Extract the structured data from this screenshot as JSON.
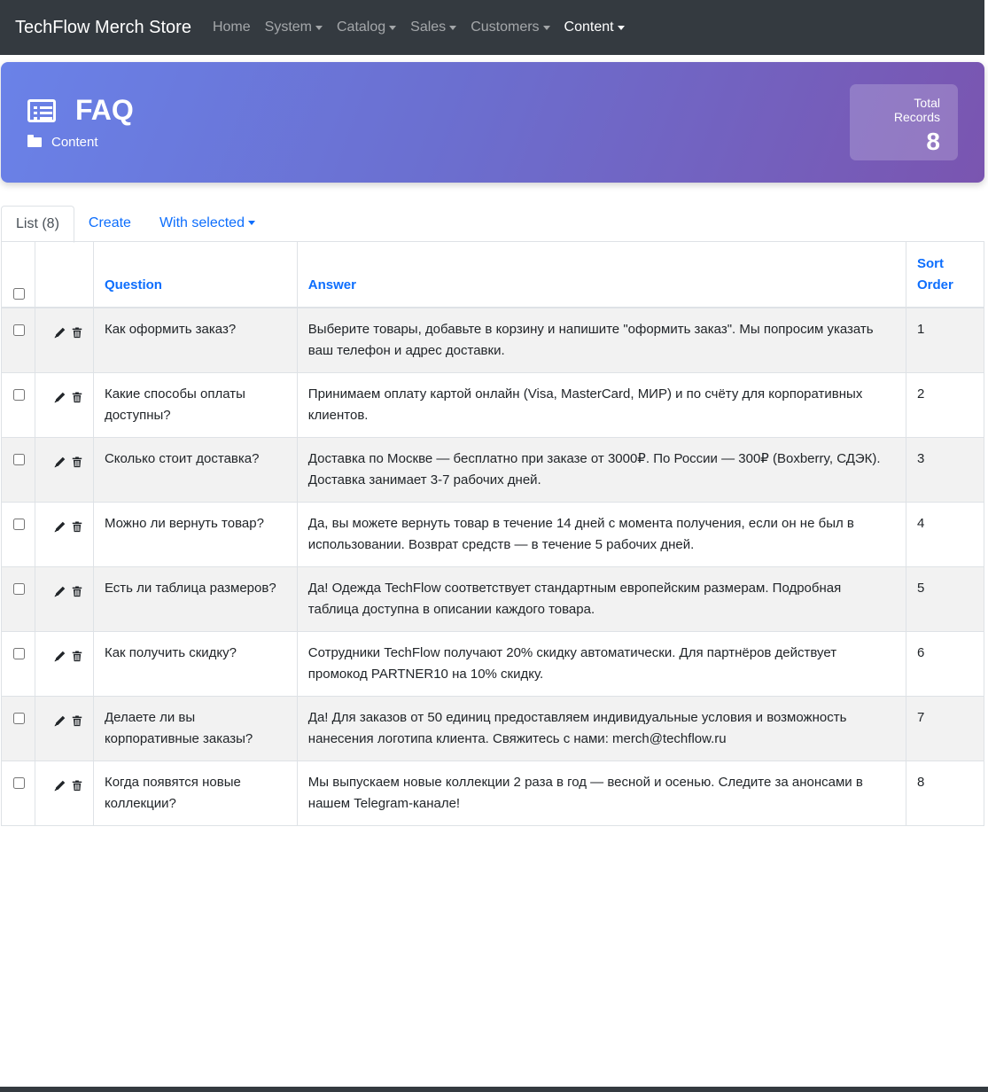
{
  "navbar": {
    "brand": "TechFlow Merch Store",
    "items": [
      {
        "label": "Home",
        "dropdown": false,
        "active": false
      },
      {
        "label": "System",
        "dropdown": true,
        "active": false
      },
      {
        "label": "Catalog",
        "dropdown": true,
        "active": false
      },
      {
        "label": "Sales",
        "dropdown": true,
        "active": false
      },
      {
        "label": "Customers",
        "dropdown": true,
        "active": false
      },
      {
        "label": "Content",
        "dropdown": true,
        "active": true
      }
    ]
  },
  "header": {
    "title": "FAQ",
    "title_icon": "list-alt-icon",
    "breadcrumb": "Content",
    "breadcrumb_icon": "folder-open-icon",
    "stats_label": "Total Records",
    "stats_value": "8"
  },
  "tabs": {
    "list": "List (8)",
    "create": "Create",
    "with_selected": "With selected"
  },
  "table": {
    "headers": {
      "question": "Question",
      "answer": "Answer",
      "sort_order": "Sort Order"
    },
    "rows": [
      {
        "question": "Как оформить заказ?",
        "answer": "Выберите товары, добавьте в корзину и напишите \"оформить заказ\". Мы попросим указать ваш телефон и адрес доставки.",
        "sort_order": "1"
      },
      {
        "question": "Какие способы оплаты доступны?",
        "answer": "Принимаем оплату картой онлайн (Visa, MasterCard, МИР) и по счёту для корпоративных клиентов.",
        "sort_order": "2"
      },
      {
        "question": "Сколько стоит доставка?",
        "answer": "Доставка по Москве — бесплатно при заказе от 3000₽. По России — 300₽ (Boxberry, СДЭК). Доставка занимает 3-7 рабочих дней.",
        "sort_order": "3"
      },
      {
        "question": "Можно ли вернуть товар?",
        "answer": "Да, вы можете вернуть товар в течение 14 дней с момента получения, если он не был в использовании. Возврат средств — в течение 5 рабочих дней.",
        "sort_order": "4"
      },
      {
        "question": "Есть ли таблица размеров?",
        "answer": "Да! Одежда TechFlow соответствует стандартным европейским размерам. Подробная таблица доступна в описании каждого товара.",
        "sort_order": "5"
      },
      {
        "question": "Как получить скидку?",
        "answer": "Сотрудники TechFlow получают 20% скидку автоматически. Для партнёров действует промокод PARTNER10 на 10% скидку.",
        "sort_order": "6"
      },
      {
        "question": "Делаете ли вы корпоративные заказы?",
        "answer": "Да! Для заказов от 50 единиц предоставляем индивидуальные условия и возможность нанесения логотипа клиента. Свяжитесь с нами: merch@techflow.ru",
        "sort_order": "7"
      },
      {
        "question": "Когда появятся новые коллекции?",
        "answer": "Мы выпускаем новые коллекции 2 раза в год — весной и осенью. Следите за анонсами в нашем Telegram-канале!",
        "sort_order": "8"
      }
    ]
  },
  "colors": {
    "navbar_bg": "#343a40",
    "link_blue": "#0d6efd",
    "banner_gradient_start": "#6a82e8",
    "banner_gradient_end": "#7a55b0",
    "striped_row": "#f2f2f2"
  }
}
